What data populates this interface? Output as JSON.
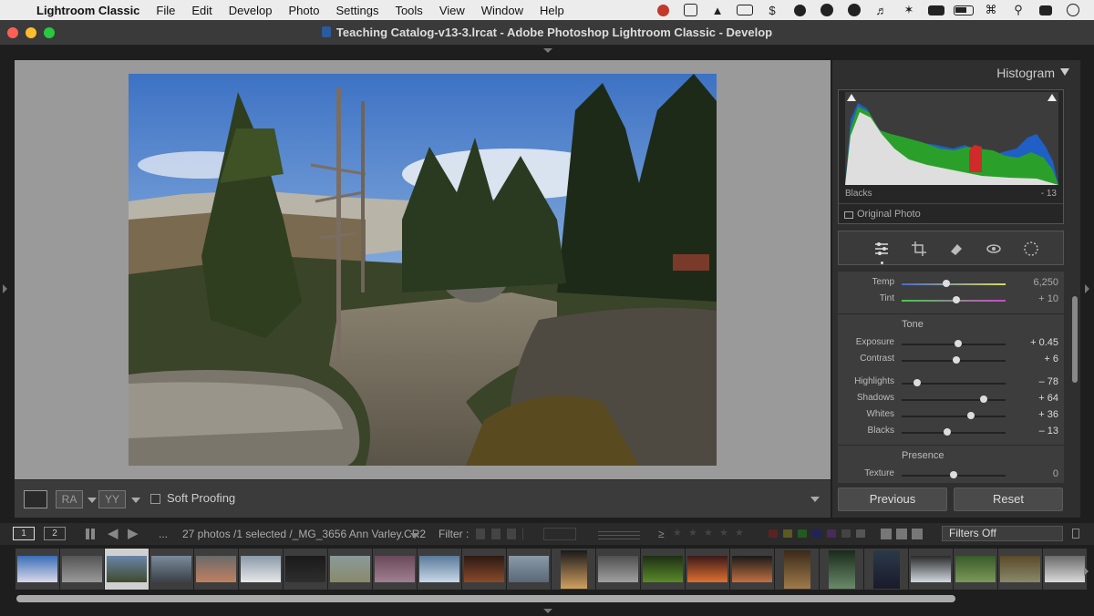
{
  "menubar": {
    "items": [
      "Lightroom Classic",
      "File",
      "Edit",
      "Develop",
      "Photo",
      "Settings",
      "Tools",
      "View",
      "Window",
      "Help"
    ]
  },
  "window": {
    "title": "Teaching Catalog-v13-3.lrcat - Adobe Photoshop Lightroom Classic - Develop"
  },
  "histogram": {
    "title": "Histogram",
    "readout_label": "Blacks",
    "readout_value": "- 13",
    "original_photo_label": "Original Photo"
  },
  "tools": [
    "sliders-icon",
    "crop-icon",
    "eraser-icon",
    "redeye-icon",
    "mask-icon"
  ],
  "develop": {
    "wb": [
      {
        "label": "Temp",
        "value": "6,250",
        "level": 0.43
      },
      {
        "label": "Tint",
        "value": "+ 10",
        "level": 0.53
      }
    ],
    "tone_title": "Tone",
    "tone": [
      {
        "label": "Exposure",
        "value": "+ 0.45",
        "level": 0.54
      },
      {
        "label": "Contrast",
        "value": "+ 6",
        "level": 0.53
      }
    ],
    "tone2": [
      {
        "label": "Highlights",
        "value": "– 78",
        "level": 0.15
      },
      {
        "label": "Shadows",
        "value": "+ 64",
        "level": 0.79
      },
      {
        "label": "Whites",
        "value": "+ 36",
        "level": 0.67
      },
      {
        "label": "Blacks",
        "value": "– 13",
        "level": 0.44
      }
    ],
    "presence_title": "Presence",
    "presence": [
      {
        "label": "Texture",
        "value": "0",
        "level": 0.5
      }
    ]
  },
  "buttons": {
    "previous": "Previous",
    "reset": "Reset"
  },
  "toolbar": {
    "view_ra": "RA",
    "view_yy": "YY",
    "soft_proofing": "Soft Proofing"
  },
  "filmstrip_bar": {
    "monitor1": "1",
    "monitor2": "2",
    "ellipsis": "...",
    "info": "27 photos /1 selected /_MG_3656 Ann Varley.CR2",
    "filter_label": "Filter :",
    "filters_value": "Filters Off"
  },
  "colors": {
    "panel_bg": "#2f2f2f",
    "viewer_bg": "#9a9a9a",
    "traffic_red": "#ff5f57",
    "traffic_yellow": "#febc2e",
    "traffic_green": "#28c840"
  },
  "thumbnails": [
    {
      "colors": [
        "#3a6fb8",
        "#d8d8e8"
      ]
    },
    {
      "colors": [
        "#555555",
        "#9a9a9a"
      ]
    },
    {
      "colors": [
        "#6a86a8",
        "#3f4a2e"
      ],
      "selected": true
    },
    {
      "colors": [
        "#7a8a9a",
        "#3a4048"
      ]
    },
    {
      "colors": [
        "#6a6a6a",
        "#c08060"
      ]
    },
    {
      "colors": [
        "#8a9aaa",
        "#e8e8e8"
      ]
    },
    {
      "colors": [
        "#1a1a1a",
        "#2e2e2e"
      ]
    },
    {
      "colors": [
        "#8a9a9a",
        "#8a8a6a"
      ]
    },
    {
      "colors": [
        "#6a4a5a",
        "#a08090"
      ]
    },
    {
      "colors": [
        "#5a7a9a",
        "#c8d8e8"
      ]
    },
    {
      "colors": [
        "#2a1a14",
        "#8a4a2a"
      ]
    },
    {
      "colors": [
        "#8a9aa8",
        "#5a6878"
      ]
    },
    {
      "colors": [
        "#1a1a1a",
        "#d0a060"
      ],
      "portrait": true
    },
    {
      "colors": [
        "#505050",
        "#a0a0a0"
      ]
    },
    {
      "colors": [
        "#1e2e14",
        "#5a8a2a"
      ]
    },
    {
      "colors": [
        "#3a1a1a",
        "#e07030"
      ]
    },
    {
      "colors": [
        "#1a1a1a",
        "#c07040"
      ]
    },
    {
      "colors": [
        "#3a2a1a",
        "#a07a4a"
      ],
      "portrait": true
    },
    {
      "colors": [
        "#1a2a1a",
        "#6a8a6a"
      ],
      "portrait": true
    },
    {
      "colors": [
        "#2a3a4a",
        "#1a1a2a"
      ],
      "portrait": true
    },
    {
      "colors": [
        "#2a2a2a",
        "#d0d8e0"
      ]
    },
    {
      "colors": [
        "#3a5a2a",
        "#7a9a5a"
      ]
    },
    {
      "colors": [
        "#5a4a2a",
        "#8a8a6a"
      ]
    },
    {
      "colors": [
        "#6a6a6a",
        "#dadada"
      ]
    }
  ]
}
